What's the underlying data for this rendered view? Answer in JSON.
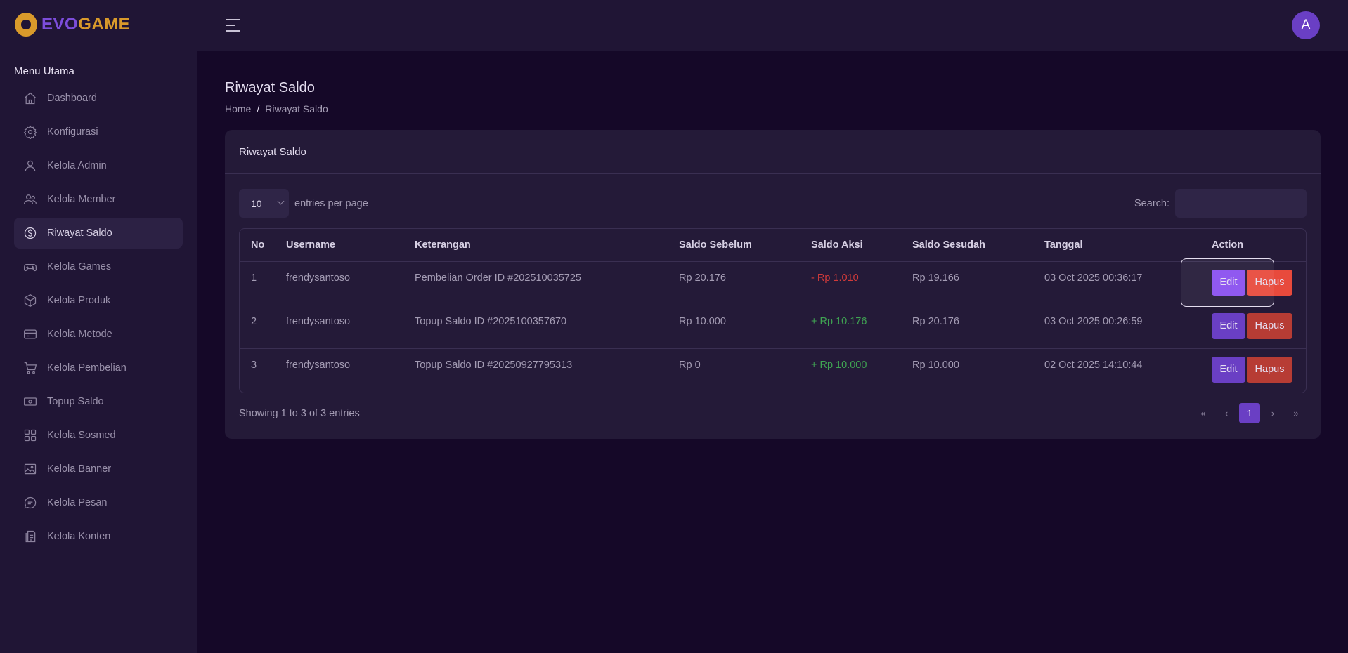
{
  "brand": {
    "part1": "EVO",
    "part2": "GAME"
  },
  "user": {
    "avatar_initial": "A"
  },
  "sidebar": {
    "heading": "Menu Utama",
    "items": [
      {
        "label": "Dashboard",
        "icon": "home-icon"
      },
      {
        "label": "Konfigurasi",
        "icon": "gear-icon"
      },
      {
        "label": "Kelola Admin",
        "icon": "user-icon"
      },
      {
        "label": "Kelola Member",
        "icon": "users-icon"
      },
      {
        "label": "Riwayat Saldo",
        "icon": "dollar-circle-icon",
        "active": true
      },
      {
        "label": "Kelola Games",
        "icon": "gamepad-icon"
      },
      {
        "label": "Kelola Produk",
        "icon": "box-icon"
      },
      {
        "label": "Kelola Metode",
        "icon": "card-icon"
      },
      {
        "label": "Kelola Pembelian",
        "icon": "cart-icon"
      },
      {
        "label": "Topup Saldo",
        "icon": "money-icon"
      },
      {
        "label": "Kelola Sosmed",
        "icon": "grid-icon"
      },
      {
        "label": "Kelola Banner",
        "icon": "image-icon"
      },
      {
        "label": "Kelola Pesan",
        "icon": "message-icon"
      },
      {
        "label": "Kelola Konten",
        "icon": "document-icon"
      }
    ]
  },
  "page": {
    "title": "Riwayat Saldo",
    "breadcrumb": {
      "home": "Home",
      "separator": "/",
      "current": "Riwayat Saldo"
    }
  },
  "card": {
    "title": "Riwayat Saldo",
    "per_page_value": "10",
    "per_page_label": "entries per page",
    "search_label": "Search:",
    "search_value": "",
    "columns": [
      "No",
      "Username",
      "Keterangan",
      "Saldo Sebelum",
      "Saldo Aksi",
      "Saldo Sesudah",
      "Tanggal",
      "Action"
    ],
    "rows": [
      {
        "no": "1",
        "username": "frendysantoso",
        "keterangan": "Pembelian Order ID #202510035725",
        "sebelum": "Rp 20.176",
        "aksi": "- Rp 1.010",
        "aksi_type": "minus",
        "sesudah": "Rp 19.166",
        "tanggal": "03 Oct 2025 00:36:17"
      },
      {
        "no": "2",
        "username": "frendysantoso",
        "keterangan": "Topup Saldo ID #2025100357670",
        "sebelum": "Rp 10.000",
        "aksi": "+ Rp 10.176",
        "aksi_type": "plus",
        "sesudah": "Rp 20.176",
        "tanggal": "03 Oct 2025 00:26:59"
      },
      {
        "no": "3",
        "username": "frendysantoso",
        "keterangan": "Topup Saldo ID #20250927795313",
        "sebelum": "Rp 0",
        "aksi": "+ Rp 10.000",
        "aksi_type": "plus",
        "sesudah": "Rp 10.000",
        "tanggal": "02 Oct 2025 14:10:44"
      }
    ],
    "edit_label": "Edit",
    "delete_label": "Hapus",
    "showing_text": "Showing 1 to 3 of 3 entries",
    "pagination": {
      "first": "«",
      "prev": "‹",
      "current": "1",
      "next": "›",
      "last": "»"
    }
  },
  "colors": {
    "accent": "#6a3fc4",
    "danger": "#b73c34",
    "minus": "#d03a3a",
    "plus": "#3fa352",
    "brand_orange": "#d99a2b"
  }
}
